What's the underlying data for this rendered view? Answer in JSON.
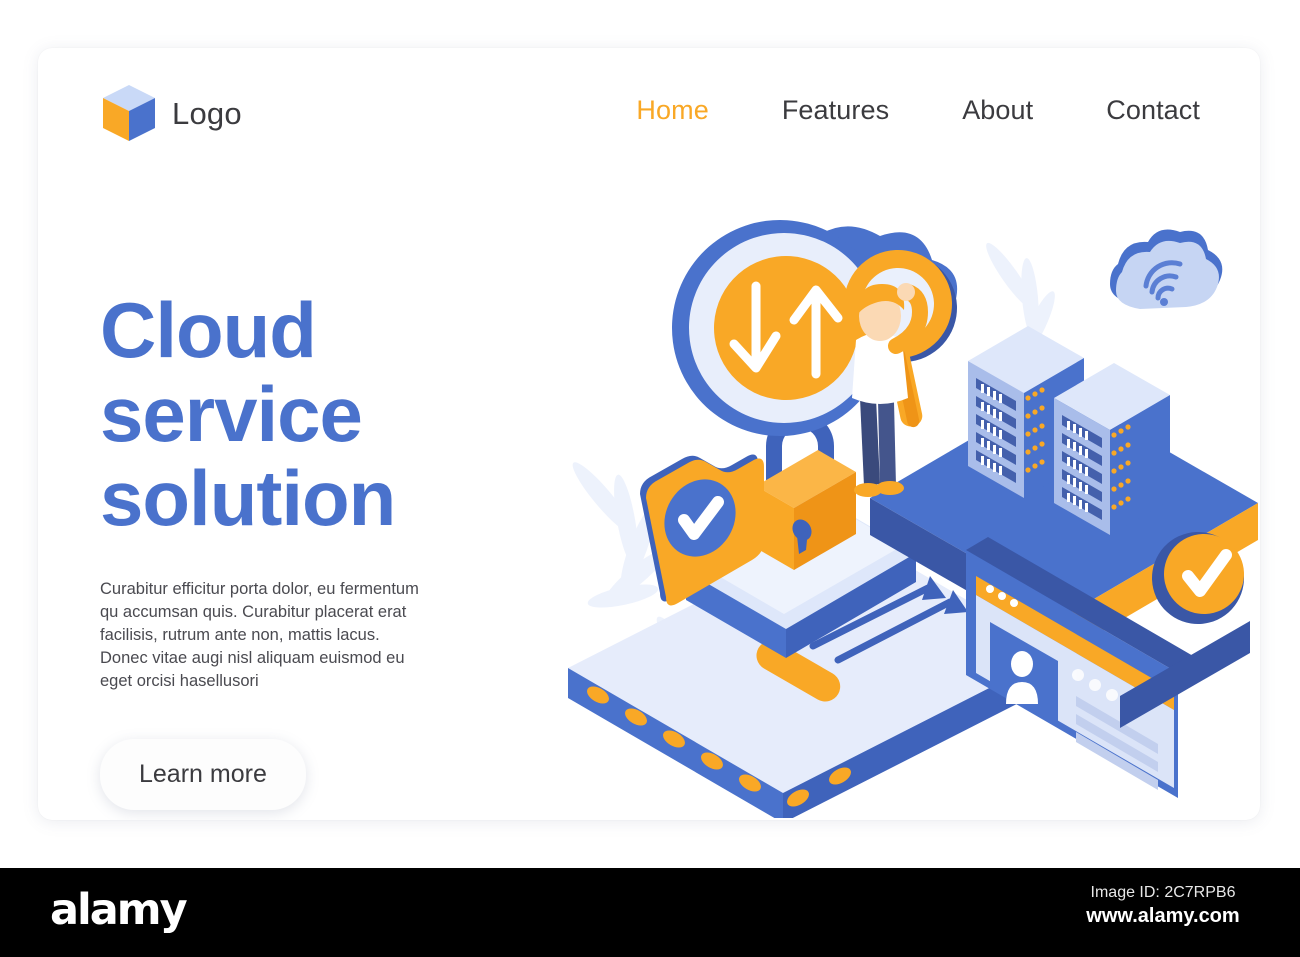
{
  "brand": {
    "logo_text": "Logo",
    "logo_icon": "cube-icon",
    "colors": {
      "primary_blue": "#4a72cc",
      "accent_orange": "#f9a826",
      "dark_blue": "#3a55a8",
      "light_blue": "#c9d6f2",
      "text_dark": "#3b3b3f"
    }
  },
  "nav": {
    "items": [
      {
        "label": "Home",
        "active": true
      },
      {
        "label": "Features",
        "active": false
      },
      {
        "label": "About",
        "active": false
      },
      {
        "label": "Contact",
        "active": false
      }
    ]
  },
  "hero": {
    "headline_lines": [
      "Cloud",
      "service",
      "solution"
    ],
    "headline": "Cloud service solution",
    "paragraph": "Curabitur efficitur porta dolor, eu fermentum qu accumsan quis. Curabitur placerat erat facilisis, rutrum ante non, mattis lacus. Donec vitae augi nisl aliquam euismod eu eget orcisi  hasellusori",
    "cta_label": "Learn more"
  },
  "illustration": {
    "alt": "Isometric cloud service illustration",
    "elements": [
      {
        "name": "data-transfer-badge",
        "icon": "up-down-arrows-icon",
        "color": "#f9a826"
      },
      {
        "name": "magnifier-icon",
        "color": "#f9a826"
      },
      {
        "name": "character-analyst",
        "hair": "#f9a826",
        "shirt": "#ffffff",
        "pants": "#3a4a7c"
      },
      {
        "name": "server-rack-left",
        "color": "#4a72cc"
      },
      {
        "name": "server-rack-right",
        "color": "#4a72cc"
      },
      {
        "name": "wifi-cloud-icon",
        "color": "#5b7fd4"
      },
      {
        "name": "verified-check-badge",
        "color": "#f9a826"
      },
      {
        "name": "folder-check-icon",
        "color": "#f9a826"
      },
      {
        "name": "padlock-icon",
        "color": "#f9a826"
      },
      {
        "name": "user-profile-card",
        "color": "#4a72cc"
      },
      {
        "name": "conveyor-platform",
        "color": "#4a72cc"
      }
    ]
  },
  "watermark": {
    "logo": "alamy",
    "image_id": "Image ID: 2C7RPB6",
    "url": "www.alamy.com"
  }
}
